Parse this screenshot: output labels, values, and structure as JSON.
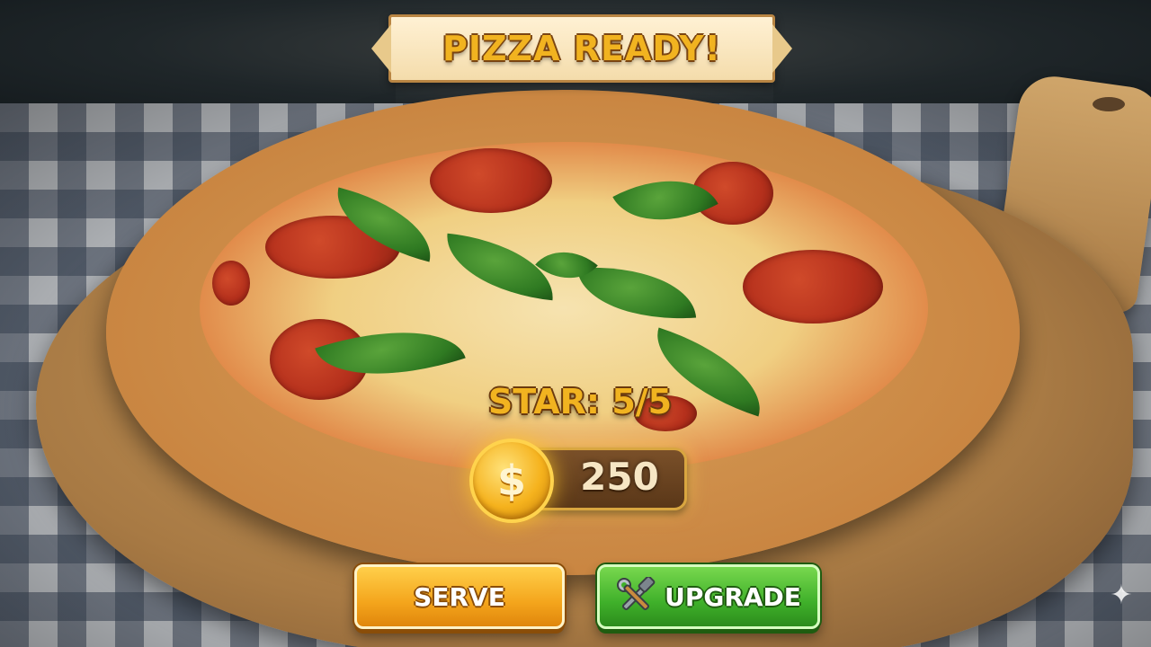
{
  "banner": {
    "title": "PIZZA READY!"
  },
  "rating": {
    "text": "STAR: 5/5",
    "stars": 5,
    "max_stars": 5
  },
  "coins": {
    "symbol": "$",
    "amount": "250"
  },
  "buttons": {
    "serve_label": "SERVE",
    "upgrade_label": "UPGRADE",
    "upgrade_icon": "tools-icon"
  },
  "colors": {
    "title_gold": "#f1b320",
    "serve_orange": "#f4a51c",
    "upgrade_green": "#3fb02a",
    "coin_gold": "#f5b21d"
  }
}
